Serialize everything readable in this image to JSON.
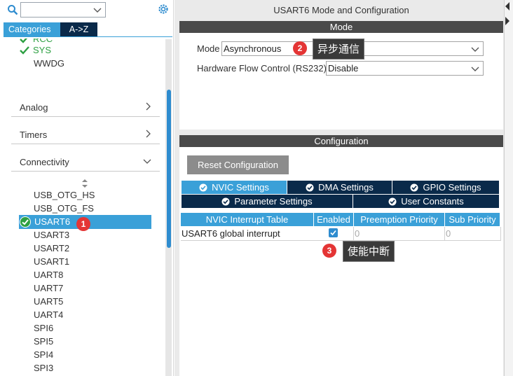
{
  "search": {
    "placeholder": ""
  },
  "tabs": {
    "categories": "Categories",
    "az": "A->Z"
  },
  "top_items": [
    "RCC",
    "SYS",
    "WWDG"
  ],
  "categories": [
    {
      "label": "Analog"
    },
    {
      "label": "Timers"
    },
    {
      "label": "Connectivity"
    }
  ],
  "connectivity_items": [
    "USB_OTG_HS",
    "USB_OTG_FS",
    "USART6",
    "USART3",
    "USART2",
    "USART1",
    "UART8",
    "UART7",
    "UART5",
    "UART4",
    "SPI6",
    "SPI5",
    "SPI4",
    "SPI3"
  ],
  "selected_item": "USART6",
  "badges": {
    "one": "1",
    "two": "2",
    "three": "3"
  },
  "panel_title": "USART6 Mode and Configuration",
  "mode": {
    "header": "Mode",
    "mode_label": "Mode",
    "mode_value": "Asynchronous",
    "flow_label": "Hardware Flow Control (RS232)",
    "flow_value": "Disable"
  },
  "tooltips": {
    "async": "异步通信",
    "interrupt": "使能中断"
  },
  "configuration": {
    "header": "Configuration",
    "reset_label": "Reset Configuration",
    "tabs": [
      "NVIC Settings",
      "DMA Settings",
      "GPIO Settings",
      "Parameter Settings",
      "User Constants"
    ],
    "table_headers": [
      "NVIC Interrupt Table",
      "Enabled",
      "Preemption Priority",
      "Sub Priority"
    ],
    "rows": [
      {
        "name": "USART6 global interrupt",
        "enabled": true,
        "preemption": "0",
        "sub": "0"
      }
    ]
  },
  "colors": {
    "accent": "#3aa0d8",
    "dark_tab": "#0a2a4a",
    "badge": "#e43535",
    "check": "#2ea043"
  }
}
